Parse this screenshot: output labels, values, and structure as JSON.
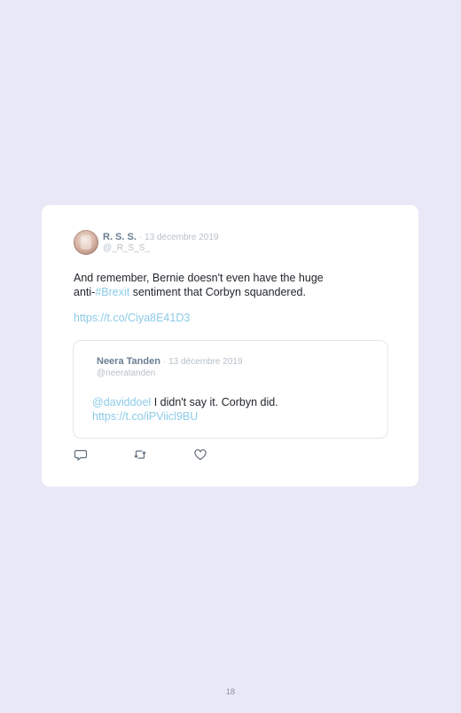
{
  "tweet": {
    "author_name": "R. S. S.",
    "date": "· 13 décembre 2019",
    "handle": "@_R_S_S_",
    "text_line1": "And remember, Bernie doesn't even have the huge",
    "text_line2_prefix": "anti-",
    "hashtag": "#Brexit",
    "text_line2_suffix": " sentiment that Corbyn squandered.",
    "url": "https://t.co/Ciya8E41D3"
  },
  "quoted_tweet": {
    "author_name": "Neera Tanden",
    "date": "· 13 décembre 2019",
    "handle": "@neeratanden",
    "mention": "@daviddoel",
    "text": " I didn't say it. Corbyn did.",
    "url": "https://t.co/iPViicl9BU"
  },
  "actions": {
    "reply_icon": "reply-icon",
    "retweet_icon": "retweet-icon",
    "like_icon": "like-icon"
  },
  "page_number": "18"
}
